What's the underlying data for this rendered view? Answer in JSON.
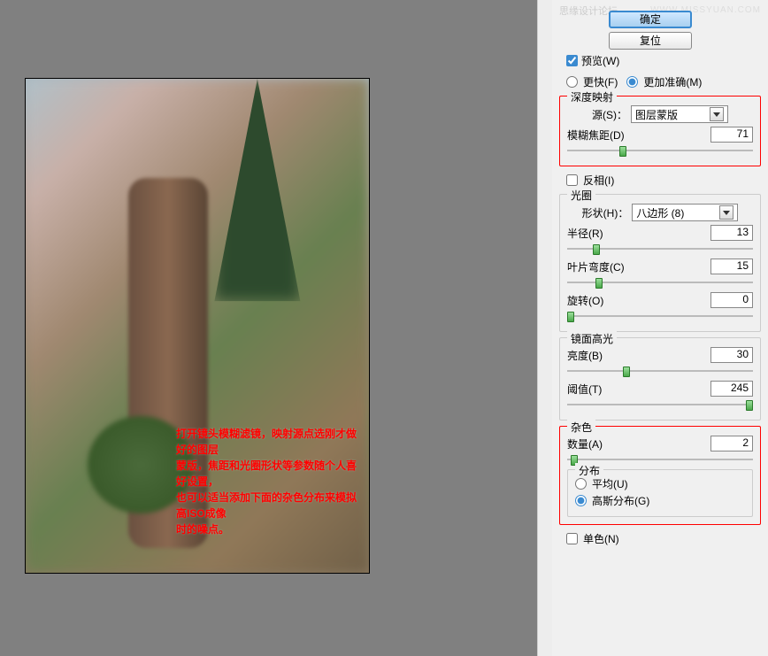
{
  "meta": {
    "watermark1": "思缘设计论坛",
    "watermark2": "WWW.MISSYUAN.COM"
  },
  "buttons": {
    "ok": "确定",
    "reset": "复位"
  },
  "preview": {
    "checkbox_label": "预览(W)",
    "faster": "更快(F)",
    "more_accurate": "更加准确(M)"
  },
  "depth_map": {
    "title": "深度映射",
    "source_label": "源(S)：",
    "source_value": "图层蒙版",
    "focal_label": "模糊焦距(D)",
    "focal_value": "71",
    "focal_pct": 28
  },
  "invert": {
    "label": "反相(I)"
  },
  "iris": {
    "title": "光圈",
    "shape_label": "形状(H)：",
    "shape_value": "八边形 (8)",
    "radius_label": "半径(R)",
    "radius_value": "13",
    "radius_pct": 14,
    "curvature_label": "叶片弯度(C)",
    "curvature_value": "15",
    "curvature_pct": 15,
    "rotation_label": "旋转(O)",
    "rotation_value": "0",
    "rotation_pct": 0
  },
  "specular": {
    "title": "镜面高光",
    "brightness_label": "亮度(B)",
    "brightness_value": "30",
    "brightness_pct": 30,
    "threshold_label": "阈值(T)",
    "threshold_value": "245",
    "threshold_pct": 96
  },
  "noise": {
    "title": "杂色",
    "amount_label": "数量(A)",
    "amount_value": "2",
    "amount_pct": 2,
    "dist_title": "分布",
    "dist_uniform": "平均(U)",
    "dist_gaussian": "高斯分布(G)"
  },
  "mono": {
    "label": "单色(N)"
  },
  "overlay": {
    "line1": "打开镜头模糊滤镜，映射源点选刚才做好的图层",
    "line2": "蒙版，焦距和光圈形状等参数随个人喜好设置，",
    "line3": "也可以适当添加下面的杂色分布来模拟高ISO成像",
    "line4": "时的噪点。"
  }
}
